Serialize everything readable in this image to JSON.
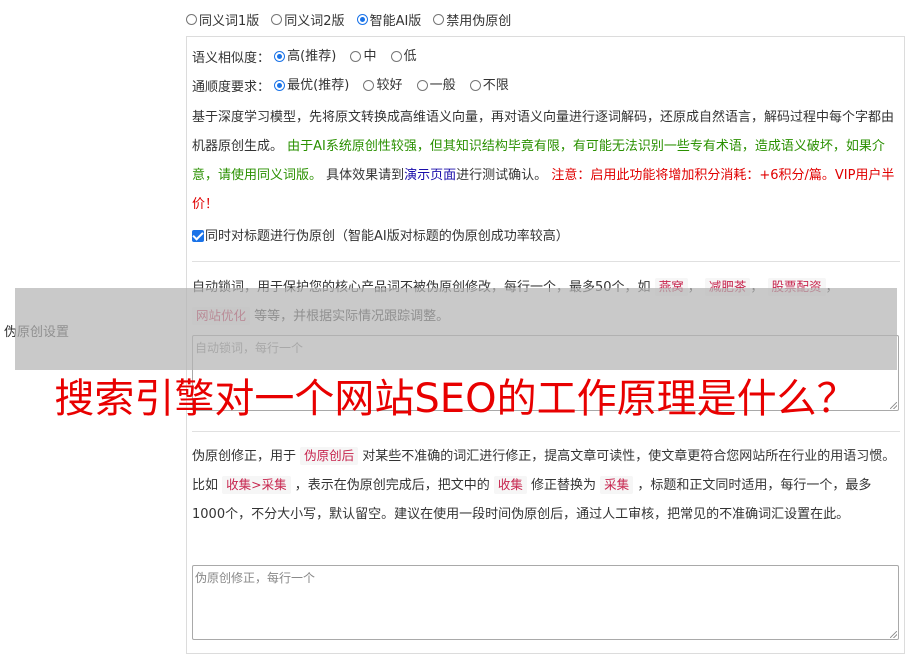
{
  "side_label": "伪原创设置",
  "modes": [
    {
      "label": "同义词1版",
      "selected": false
    },
    {
      "label": "同义词2版",
      "selected": false
    },
    {
      "label": "智能AI版",
      "selected": true
    },
    {
      "label": "禁用伪原创",
      "selected": false
    }
  ],
  "similarity": {
    "label": "语义相似度：",
    "options": [
      {
        "label": "高(推荐)",
        "selected": true
      },
      {
        "label": "中",
        "selected": false
      },
      {
        "label": "低",
        "selected": false
      }
    ]
  },
  "fluency": {
    "label": "通顺度要求：",
    "options": [
      {
        "label": "最优(推荐)",
        "selected": true
      },
      {
        "label": "较好",
        "selected": false
      },
      {
        "label": "一般",
        "selected": false
      },
      {
        "label": "不限",
        "selected": false
      }
    ]
  },
  "ai_desc": {
    "intro": "基于深度学习模型，先将原文转换成高维语义向量，再对语义向量进行逐词解码，还原成自然语言，解码过程中每个字都由机器原创生成。 ",
    "warning_green": "由于AI系统原创性较强，但其知识结构毕竟有限，有可能无法识别一些专有术语，造成语义破坏，如果介意，请使用同义词版。",
    "effect_prefix": " 具体效果请到",
    "demo_link": "演示页面",
    "effect_suffix": "进行测试确认。 ",
    "cost_note": "注意：启用此功能将增加积分消耗：+6积分/篇。VIP用户半价！"
  },
  "title_checkbox": {
    "label": "同时对标题进行伪原创（智能AI版对标题的伪原创成功率较高）",
    "checked": true
  },
  "lock_words": {
    "desc_prefix": "自动锁词，用于保护您的核心产品词不被伪原创修改，每行一个，最多50个，如",
    "examples": [
      "燕窝",
      "减肥茶",
      "股票配资",
      "网站优化"
    ],
    "sep": "，",
    "desc_suffix": " 等等，并根据实际情况跟踪调整。",
    "placeholder": "自动锁词，每行一个"
  },
  "headline": "搜索引擎对一个网站SEO的工作原理是什么？",
  "correction": {
    "p1": "伪原创修正，用于 ",
    "tag1": "伪原创后",
    "p2": " 对某些不准确的词汇进行修正，提高文章可读性，使文章更符合您网站所在行业的用语习惯。比如 ",
    "tag2": "收集>采集",
    "p3": " ，表示在伪原创完成后，把文中的 ",
    "tag3": "收集",
    "p4": " 修正替换为 ",
    "tag4": "采集",
    "p5": " ，标题和正文同时适用，每行一个，最多1000个，不分大小写，默认留空。建议在使用一段时间伪原创后，通过人工审核，把常见的不准确词汇设置在此。",
    "placeholder": "伪原创修正，每行一个"
  },
  "colors": {
    "accent": "#1a73e8",
    "green": "#2a9000",
    "red": "#e00000",
    "headline": "#e80000"
  }
}
